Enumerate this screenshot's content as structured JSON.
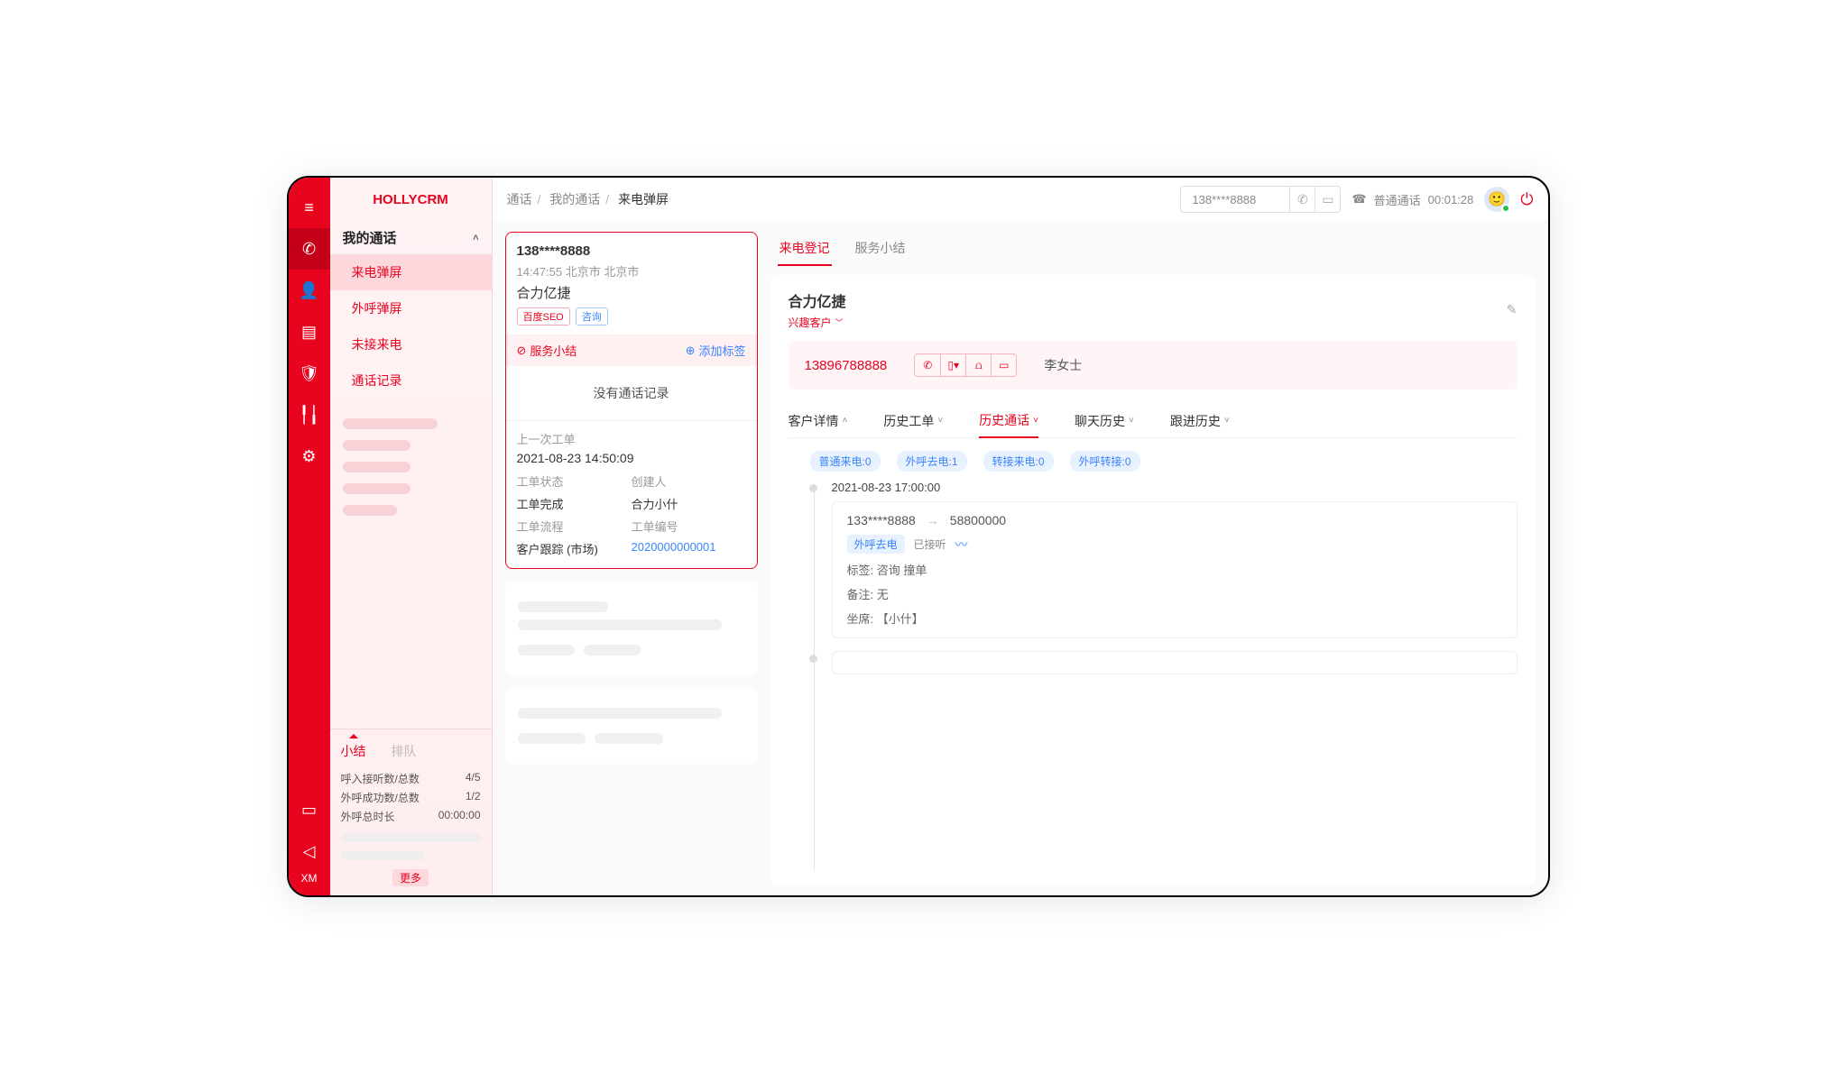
{
  "brand": "HOLLYCRM",
  "breadcrumbs": {
    "a": "通话",
    "b": "我的通话",
    "c": "来电弹屏"
  },
  "header": {
    "phone_value": "138****8888",
    "call_status_label": "普通通话",
    "call_duration": "00:01:28"
  },
  "sidebar": {
    "group": "我的通话",
    "items": [
      "来电弹屏",
      "外呼弹屏",
      "未接来电",
      "通话记录"
    ]
  },
  "bottom_panel": {
    "tabs": [
      "小结",
      "排队"
    ],
    "rows": {
      "r1_label": "呼入接听数/总数",
      "r1_val": "4/5",
      "r2_label": "外呼成功数/总数",
      "r2_val": "1/2",
      "r3_label": "外呼总时长",
      "r3_val": "00:00:00"
    },
    "more": "更多"
  },
  "call_card": {
    "phone": "138****8888",
    "ts": "14:47:55 北京市  北京市",
    "company": "合力亿捷",
    "tag1": "百度SEO",
    "tag2": "咨询",
    "action_summary": "服务小结",
    "action_addtag": "添加标签",
    "empty": "没有通话记录",
    "prev_label": "上一次工单",
    "prev_time": "2021-08-23 14:50:09",
    "k1": "工单状态",
    "k2": "创建人",
    "v1": "工单完成",
    "v2": "合力小什",
    "k3": "工单流程",
    "k4": "工单编号",
    "v3": "客户跟踪 (市场)",
    "v4": "2020000000001"
  },
  "right": {
    "tabs": [
      "来电登记",
      "服务小结"
    ],
    "customer_name": "合力亿捷",
    "customer_tag": "兴趣客户",
    "pink_phone": "13896788888",
    "owner": "李女士",
    "subtabs": [
      "客户详情",
      "历史工单",
      "历史通话",
      "聊天历史",
      "跟进历史"
    ],
    "pills": {
      "p1": "普通来电:0",
      "p2": "外呼去电:1",
      "p3": "转接来电:0",
      "p4": "外呼转接:0"
    },
    "timeline": {
      "time": "2021-08-23  17:00:00",
      "from": "133****8888",
      "to": "58800000",
      "type": "外呼去电",
      "status": "已接听",
      "tags_label": "标签:",
      "tags_val": "咨询   撞单",
      "note_label": "备注:",
      "note_val": "无",
      "agent_label": "坐席:",
      "agent_val": "【小什】"
    }
  }
}
